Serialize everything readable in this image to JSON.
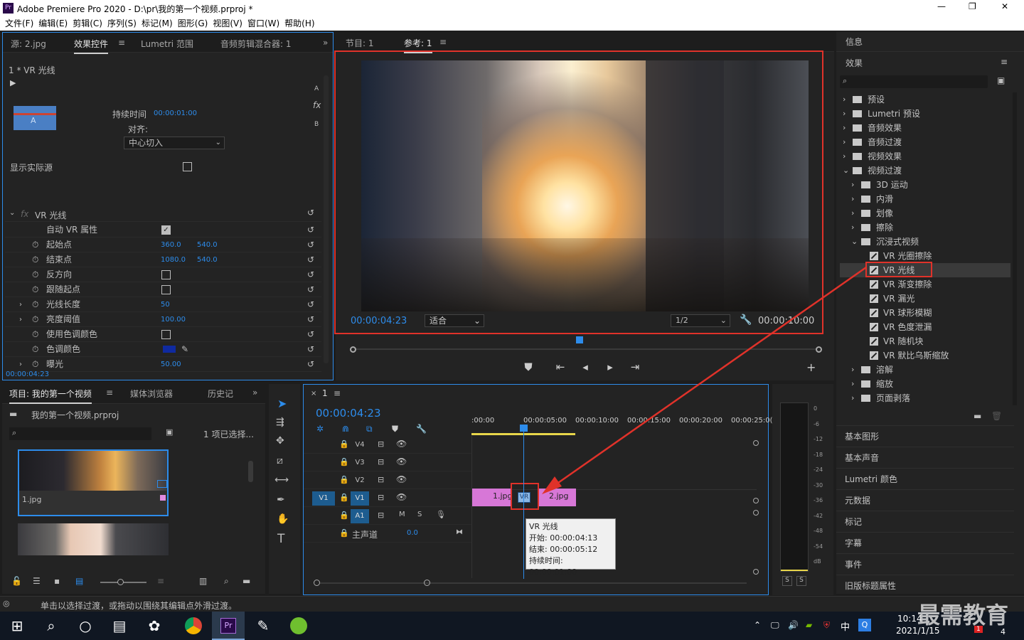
{
  "window": {
    "title": "Adobe Premiere Pro 2020 - D:\\pr\\我的第一个视频.prproj *",
    "controls": [
      "—",
      "❐",
      "✕"
    ]
  },
  "menu": [
    "文件(F)",
    "编辑(E)",
    "剪辑(C)",
    "序列(S)",
    "标记(M)",
    "图形(G)",
    "视图(V)",
    "窗口(W)",
    "帮助(H)"
  ],
  "effect_controls": {
    "tabs": [
      "源: 2.jpg",
      "效果控件",
      "Lumetri 范围",
      "音频剪辑混合器: 1"
    ],
    "clip": "1 * VR 光线",
    "duration_label": "持续时间",
    "duration": "00:00:01:00",
    "align_label": "对齐:",
    "align_value": "中心切入",
    "letters": [
      "A",
      "B"
    ],
    "show_source": "显示实际源",
    "effect_name": "VR 光线",
    "props": [
      {
        "label": "自动 VR 属性",
        "type": "check-on"
      },
      {
        "label": "起始点",
        "v1": "360.0",
        "v2": "540.0"
      },
      {
        "label": "结束点",
        "v1": "1080.0",
        "v2": "540.0"
      },
      {
        "label": "反方向",
        "type": "check"
      },
      {
        "label": "跟随起点",
        "type": "check"
      },
      {
        "label": "光线长度",
        "v1": "50"
      },
      {
        "label": "亮度阈值",
        "v1": "100.00"
      },
      {
        "label": "使用色调颜色",
        "type": "check"
      },
      {
        "label": "色调颜色",
        "type": "color"
      },
      {
        "label": "曝光",
        "v1": "50.00"
      }
    ],
    "timecode": "00:00:04:23"
  },
  "program": {
    "tabs": [
      "节目: 1",
      "参考: 1"
    ],
    "timecode": "00:00:04:23",
    "fit": "适合",
    "resolution": "1/2",
    "duration": "00:00:10:00"
  },
  "project": {
    "tabs": [
      "项目: 我的第一个视频",
      "媒体浏览器",
      "历史记"
    ],
    "file": "我的第一个视频.prproj",
    "selected": "1 项已选择...",
    "items": [
      "1.jpg"
    ]
  },
  "timeline": {
    "tab": "1",
    "timecode": "00:00:04:23",
    "ruler": [
      ":00:00",
      "00:00:05:00",
      "00:00:10:00",
      "00:00:15:00",
      "00:00:20:00",
      "00:00:25:0("
    ],
    "tracks": [
      "V4",
      "V3",
      "V2",
      "V1",
      "A1"
    ],
    "source_track": "V1",
    "master": "主声道",
    "master_value": "0.0",
    "clips": [
      "1.jpg",
      "VR",
      "2.jpg"
    ],
    "tooltip": [
      "VR 光线",
      "开始: 00:00:04:13",
      "结束: 00:00:05:12",
      "持续时间: 00:00:01:00"
    ]
  },
  "meter": {
    "scale": [
      "0",
      "-6",
      "-12",
      "-18",
      "-24",
      "-30",
      "-36",
      "-42",
      "-48",
      "-54",
      "dB"
    ],
    "solo": [
      "S",
      "S"
    ]
  },
  "right": {
    "info": "信息",
    "effects_title": "效果",
    "tree": [
      {
        "label": "预设",
        "level": 0,
        "arrow": "›"
      },
      {
        "label": "Lumetri 预设",
        "level": 0,
        "arrow": "›"
      },
      {
        "label": "音频效果",
        "level": 0,
        "arrow": "›"
      },
      {
        "label": "音频过渡",
        "level": 0,
        "arrow": "›"
      },
      {
        "label": "视频效果",
        "level": 0,
        "arrow": "›"
      },
      {
        "label": "视频过渡",
        "level": 0,
        "arrow": "⌄"
      },
      {
        "label": "3D 运动",
        "level": 1,
        "arrow": "›"
      },
      {
        "label": "内滑",
        "level": 1,
        "arrow": "›"
      },
      {
        "label": "划像",
        "level": 1,
        "arrow": "›"
      },
      {
        "label": "擦除",
        "level": 1,
        "arrow": "›"
      },
      {
        "label": "沉浸式视频",
        "level": 1,
        "arrow": "⌄"
      },
      {
        "label": "VR 光圈擦除",
        "level": 2
      },
      {
        "label": "VR 光线",
        "level": 2,
        "selected": true
      },
      {
        "label": "VR 渐变擦除",
        "level": 2
      },
      {
        "label": "VR 漏光",
        "level": 2
      },
      {
        "label": "VR 球形模糊",
        "level": 2
      },
      {
        "label": "VR 色度泄漏",
        "level": 2
      },
      {
        "label": "VR 随机块",
        "level": 2
      },
      {
        "label": "VR 默比乌斯缩放",
        "level": 2
      },
      {
        "label": "溶解",
        "level": 1,
        "arrow": "›"
      },
      {
        "label": "缩放",
        "level": 1,
        "arrow": "›"
      },
      {
        "label": "页面剥落",
        "level": 1,
        "arrow": "›"
      }
    ],
    "panels": [
      "基本图形",
      "基本声音",
      "Lumetri 颜色",
      "元数据",
      "标记",
      "字幕",
      "事件",
      "旧版标题属性"
    ]
  },
  "status": "单击以选择过渡，或拖动以围绕其编辑点外滑过渡。",
  "taskbar": {
    "time": "10:14",
    "date": "2021/1/15",
    "ime": "中",
    "watermark": "最需教育",
    "badge1": "1",
    "badge2": "4"
  }
}
